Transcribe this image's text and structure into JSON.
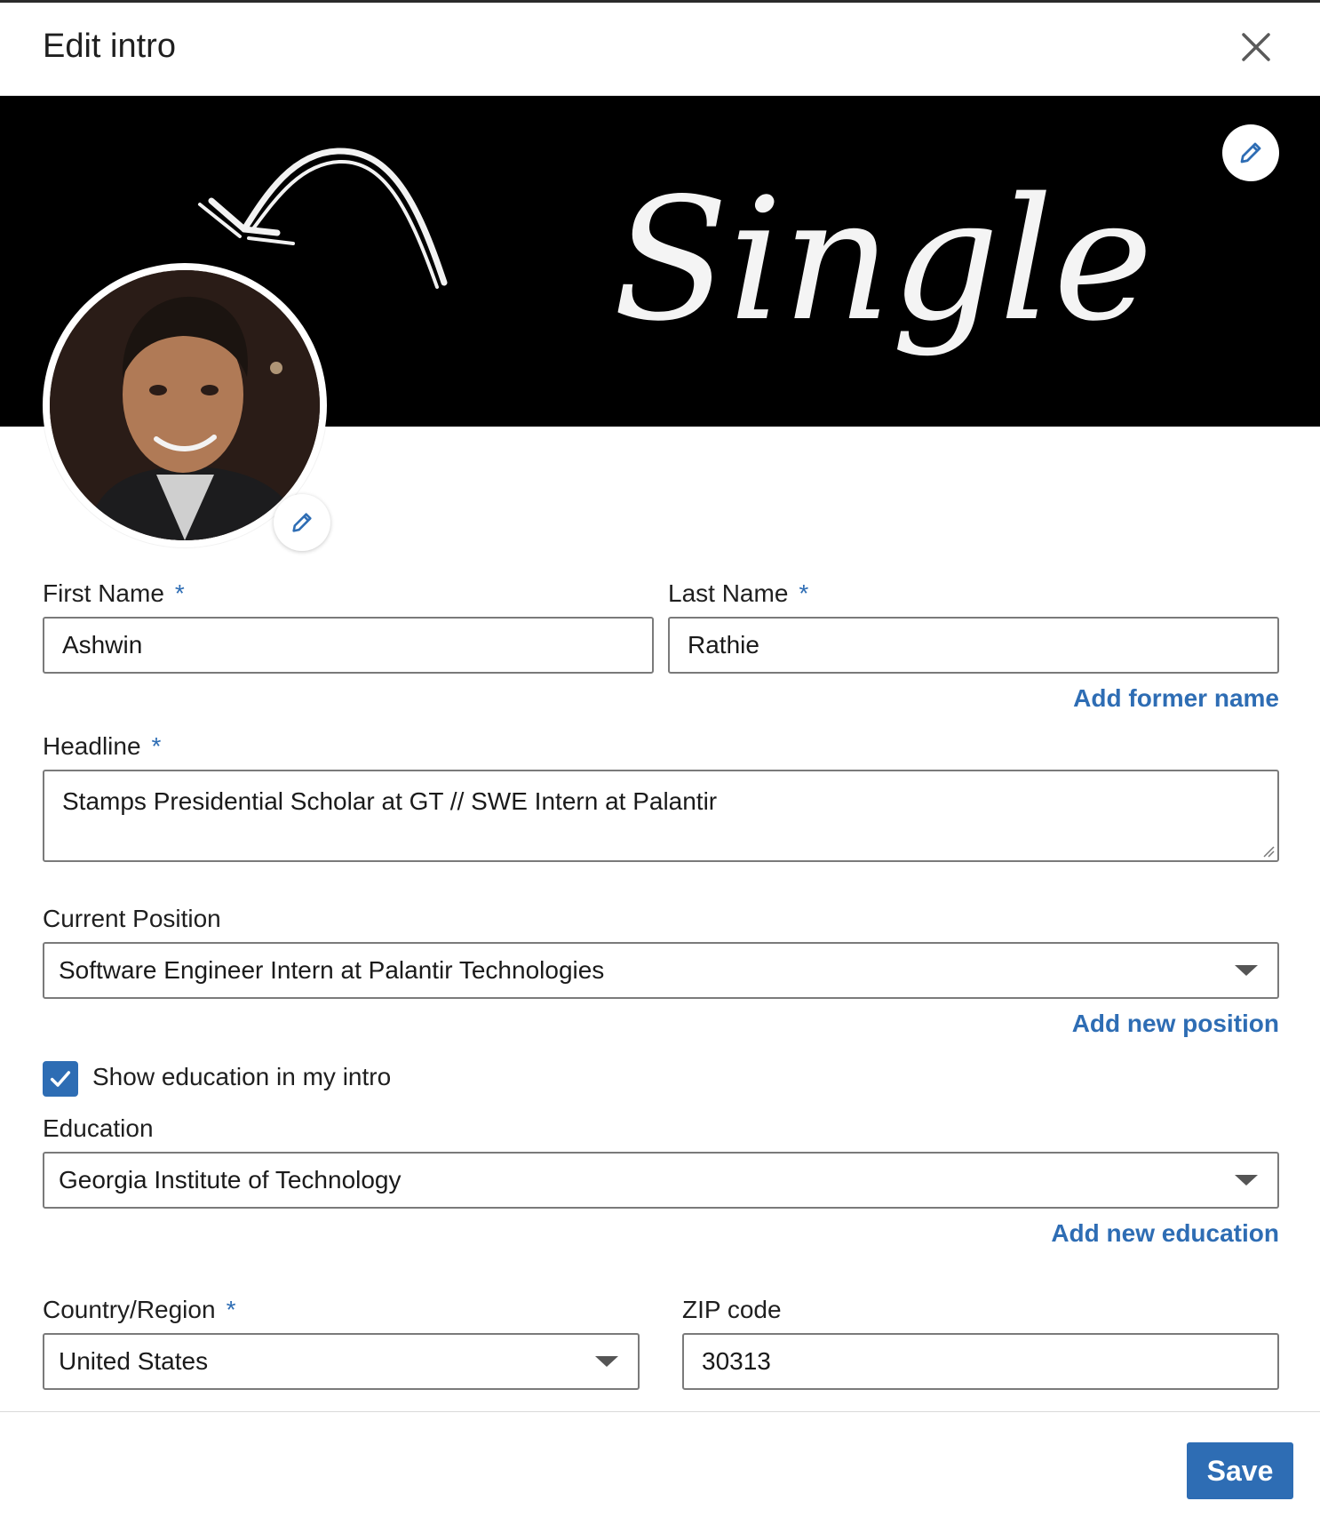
{
  "dialog": {
    "title": "Edit intro",
    "close_icon": "close-icon"
  },
  "banner": {
    "text": "Single",
    "edit_icon": "pencil-icon"
  },
  "avatar": {
    "edit_icon": "pencil-icon"
  },
  "form": {
    "first_name": {
      "label": "First Name",
      "required": "*",
      "value": "Ashwin"
    },
    "last_name": {
      "label": "Last Name",
      "required": "*",
      "value": "Rathie"
    },
    "add_former_name": "Add former name",
    "headline": {
      "label": "Headline",
      "required": "*",
      "value": "Stamps Presidential Scholar at GT // SWE Intern at Palantir"
    },
    "current_position": {
      "label": "Current Position",
      "value": "Software Engineer Intern at Palantir Technologies"
    },
    "add_new_position": "Add new position",
    "show_education": {
      "label": "Show education in my intro",
      "checked": true
    },
    "education": {
      "label": "Education",
      "value": "Georgia Institute of Technology"
    },
    "add_new_education": "Add new education",
    "country": {
      "label": "Country/Region",
      "required": "*",
      "value": "United States"
    },
    "zip": {
      "label": "ZIP code",
      "value": "30313"
    }
  },
  "footer": {
    "save_label": "Save"
  },
  "colors": {
    "accent": "#2e6db4",
    "border": "#7a7a7a",
    "banner_bg": "#000000"
  }
}
